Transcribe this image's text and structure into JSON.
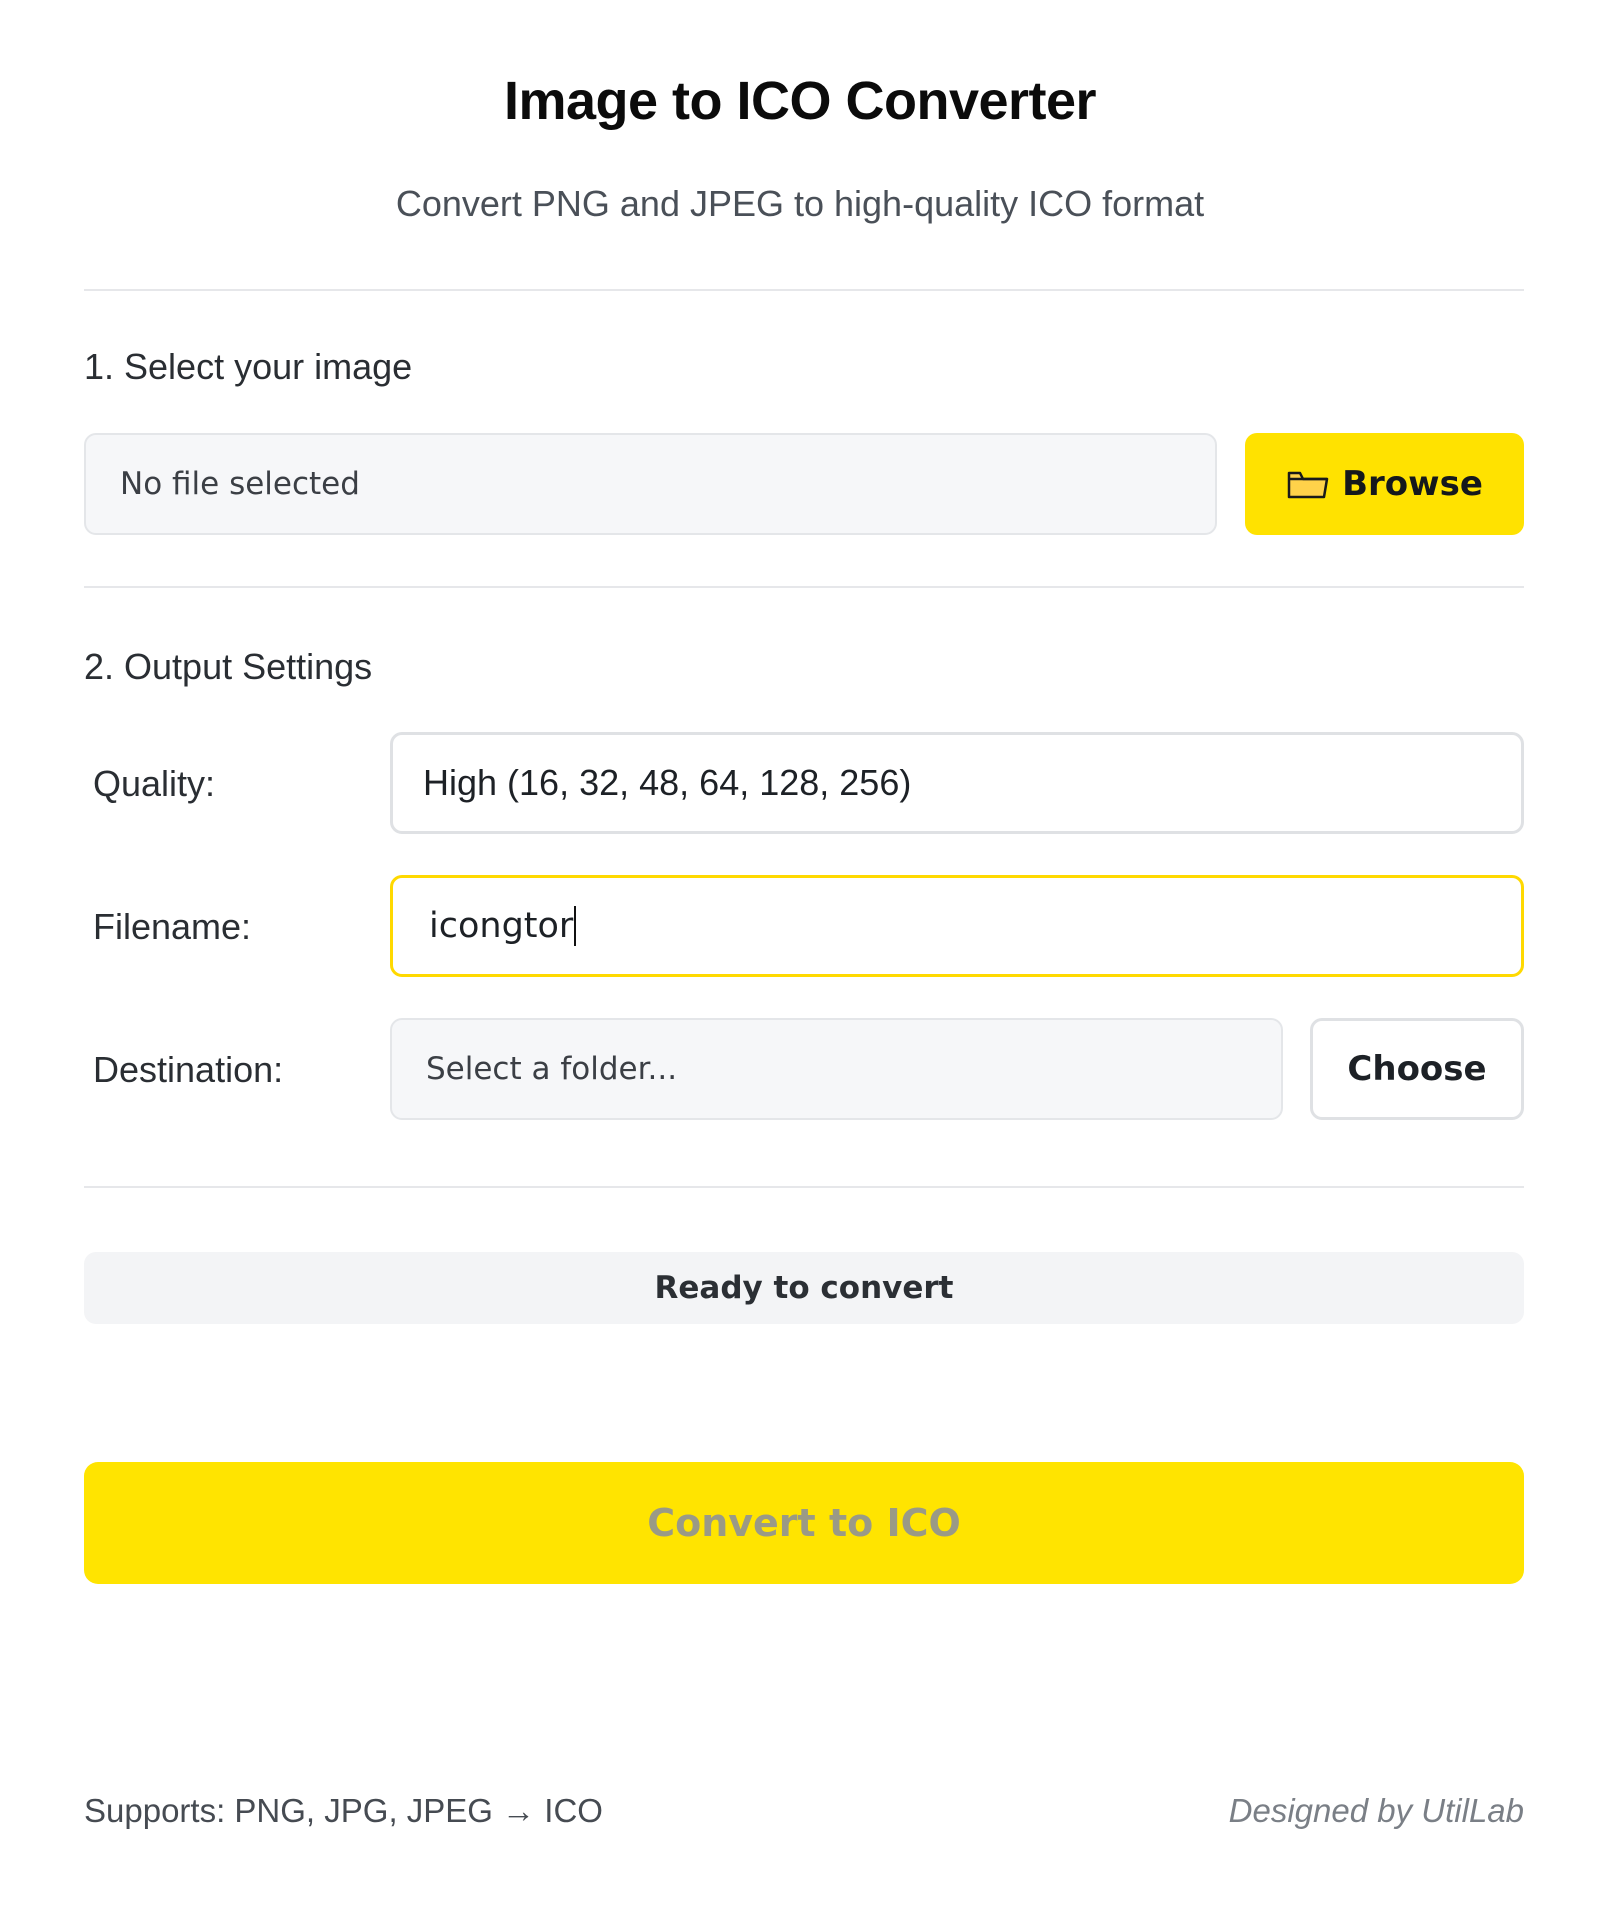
{
  "header": {
    "title": "Image to ICO Converter",
    "subtitle": "Convert PNG and JPEG to high-quality ICO format"
  },
  "select_section": {
    "label": "1. Select your image",
    "file_display": "No file selected",
    "browse_label": "Browse",
    "browse_icon": "folder-icon"
  },
  "output_section": {
    "label": "2. Output Settings",
    "quality": {
      "label": "Quality:",
      "value": "High (16, 32, 48, 64, 128, 256)"
    },
    "filename": {
      "label": "Filename:",
      "value": "icongtor"
    },
    "destination": {
      "label": "Destination:",
      "placeholder": "Select a folder...",
      "choose_label": "Choose"
    }
  },
  "status": {
    "text": "Ready to convert"
  },
  "convert": {
    "label": "Convert to ICO"
  },
  "footer": {
    "supports": "Supports: PNG, JPG, JPEG → ICO",
    "credit": "Designed by UtilLab"
  },
  "colors": {
    "accent": "#ffe200",
    "focus_border": "#ffd900",
    "input_bg": "#f6f7f9",
    "border": "#dfe1e4"
  }
}
